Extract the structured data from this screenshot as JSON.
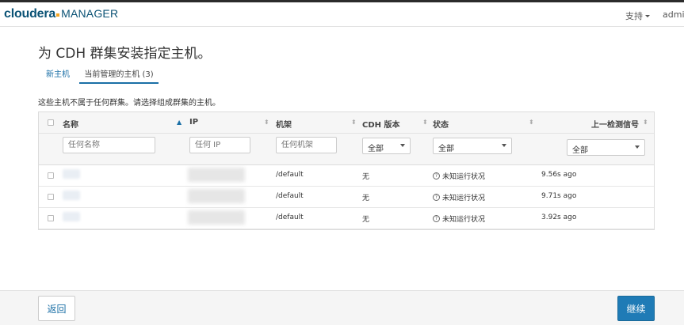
{
  "brand": {
    "primary": "cloudera",
    "secondary": "MANAGER"
  },
  "nav": {
    "support": "支持",
    "user": "admin"
  },
  "page_title": "为 CDH 群集安装指定主机。",
  "tabs": [
    {
      "label": "新主机"
    },
    {
      "label": "当前管理的主机 (3)"
    }
  ],
  "description": "这些主机不属于任何群集。请选择组成群集的主机。",
  "table": {
    "columns": [
      "名称",
      "IP",
      "机架",
      "CDH 版本",
      "状态",
      "上一检测信号"
    ],
    "filters": {
      "name_placeholder": "任何名称",
      "ip_placeholder": "任何 IP",
      "rack_placeholder": "任何机架",
      "cdh_selected": "全部",
      "status_selected": "全部",
      "heartbeat_selected": "全部"
    },
    "rows": [
      {
        "rack": "/default",
        "cdh": "无",
        "status": "未知运行状况",
        "heartbeat": "9.56s ago"
      },
      {
        "rack": "/default",
        "cdh": "无",
        "status": "未知运行状况",
        "heartbeat": "9.71s ago"
      },
      {
        "rack": "/default",
        "cdh": "无",
        "status": "未知运行状况",
        "heartbeat": "3.92s ago"
      }
    ]
  },
  "footer": {
    "back_label": "返回",
    "continue_label": "继续"
  },
  "colors": {
    "accent": "#1f7bb6",
    "brand": "#0a5275",
    "brand_dot": "#f5a623"
  }
}
